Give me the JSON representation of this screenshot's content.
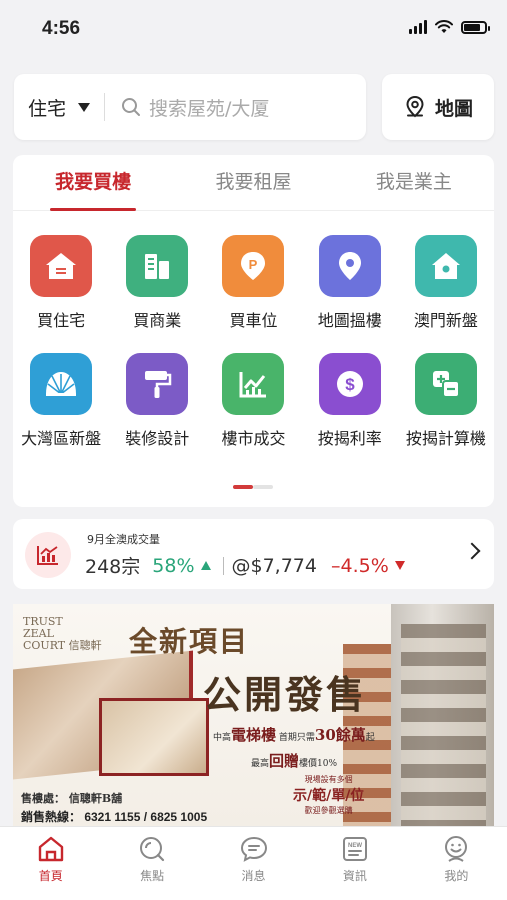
{
  "status_bar": {
    "time": "4:56"
  },
  "search": {
    "type_label": "住宅",
    "placeholder": "搜索屋苑/大厦",
    "map_label": "地圖"
  },
  "tabs": [
    {
      "label": "我要買樓",
      "active": true
    },
    {
      "label": "我要租屋",
      "active": false
    },
    {
      "label": "我是業主",
      "active": false
    }
  ],
  "grid": [
    {
      "label": "買住宅",
      "icon": "house-icon",
      "color": "#e0574a"
    },
    {
      "label": "買商業",
      "icon": "buildings-icon",
      "color": "#3fb07f"
    },
    {
      "label": "買車位",
      "icon": "parking-icon",
      "color": "#f08c3c"
    },
    {
      "label": "地圖搵樓",
      "icon": "map-pin-icon",
      "color": "#6c72dc"
    },
    {
      "label": "澳門新盤",
      "icon": "home-icon",
      "color": "#3fb8ad"
    },
    {
      "label": "大灣區新盤",
      "icon": "shell-icon",
      "color": "#2f9fd6"
    },
    {
      "label": "裝修設計",
      "icon": "paint-roller-icon",
      "color": "#7c5bc6"
    },
    {
      "label": "樓市成交",
      "icon": "chart-icon",
      "color": "#49b46a"
    },
    {
      "label": "按揭利率",
      "icon": "dollar-icon",
      "color": "#8a4ed0"
    },
    {
      "label": "按揭計算機",
      "icon": "calculator-icon",
      "color": "#3cae74"
    }
  ],
  "stats": {
    "title": "9月全澳成交量",
    "count": "248宗",
    "count_change": "58%",
    "avg_price": "@$7,774",
    "price_change": "–4.5%"
  },
  "banner": {
    "logo_line1": "TRUST",
    "logo_line2": "ZEAL",
    "logo_line3": "COURT",
    "logo_cn": "信聰軒",
    "headline1": "全新項目",
    "headline2": "公開發售",
    "mid_a": "中高",
    "mid_b": "電梯樓",
    "mid_c": "首期只需",
    "mid_d": "30餘萬",
    "mid_e": "起",
    "mid2_a": "最高",
    "mid2_b": "回贈",
    "mid2_c": "樓價10%",
    "show_a": "現場設有多個",
    "show_b": "示/範/單/位",
    "show_c": "歡迎參觀選購",
    "office": "售樓處： 信聰軒B舖",
    "hotline": "銷售熱線： 6321 1155 / 6825 1005"
  },
  "tabbar": [
    {
      "label": "首頁",
      "icon": "home-icon",
      "active": true
    },
    {
      "label": "焦點",
      "icon": "focus-icon",
      "active": false
    },
    {
      "label": "消息",
      "icon": "chat-icon",
      "active": false
    },
    {
      "label": "資訊",
      "icon": "news-icon",
      "active": false
    },
    {
      "label": "我的",
      "icon": "profile-icon",
      "active": false
    }
  ],
  "colors": {
    "accent": "#c7272d",
    "up": "#2aa57a",
    "down": "#d02a2a"
  }
}
